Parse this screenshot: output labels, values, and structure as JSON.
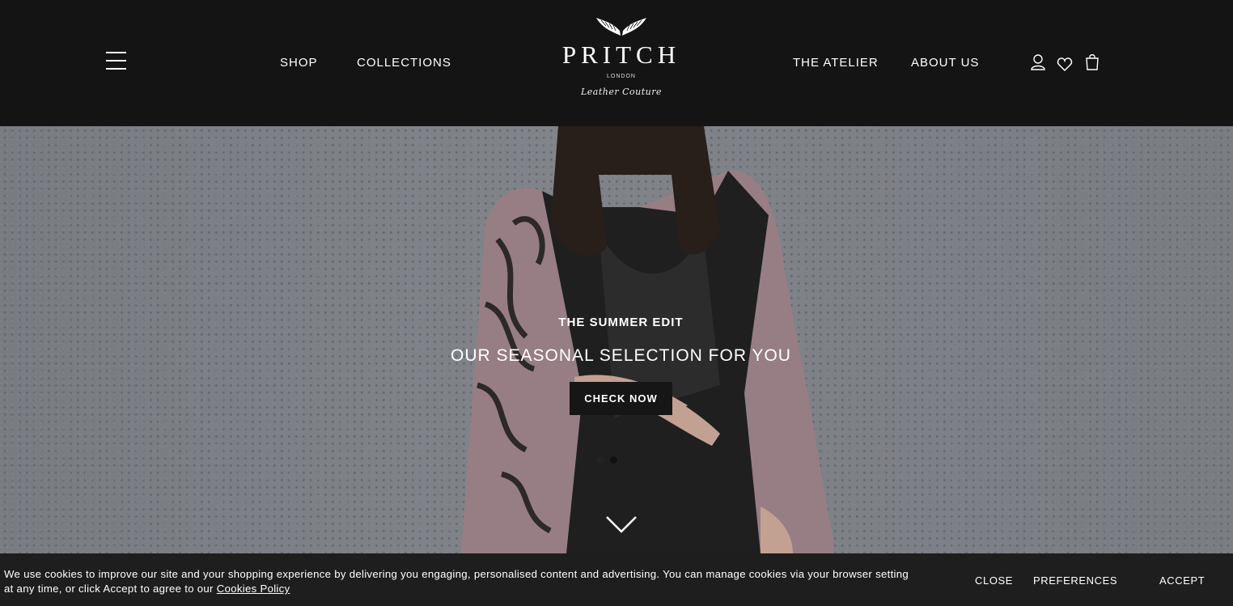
{
  "header": {
    "nav_left": [
      "SHOP",
      "COLLECTIONS"
    ],
    "nav_right": [
      "THE ATELIER",
      "ABOUT US"
    ],
    "logo": {
      "name": "PRITCH",
      "city": "LONDON",
      "tagline": "Leather Couture"
    },
    "icons": [
      "hamburger-menu-icon",
      "account-icon",
      "heart-icon",
      "shopping-bag-icon"
    ]
  },
  "hero": {
    "eyebrow": "THE SUMMER EDIT",
    "title": "OUR SEASONAL SELECTION FOR YOU",
    "cta": "CHECK NOW",
    "slide_count": 2,
    "active_slide": 2
  },
  "cookie": {
    "line1": "We use cookies to improve our site and your shopping experience by delivering you engaging, personalised content and advertising. You can manage cookies via your browser setting",
    "line2": "at any time, or click Accept to agree to our",
    "link": "Cookies Policy",
    "close": "CLOSE",
    "preferences": "PREFERENCES",
    "accept": "ACCEPT"
  },
  "colors": {
    "header_bg": "#141414",
    "cookie_bg": "#1e1e1e",
    "cta_bg": "#161616"
  }
}
